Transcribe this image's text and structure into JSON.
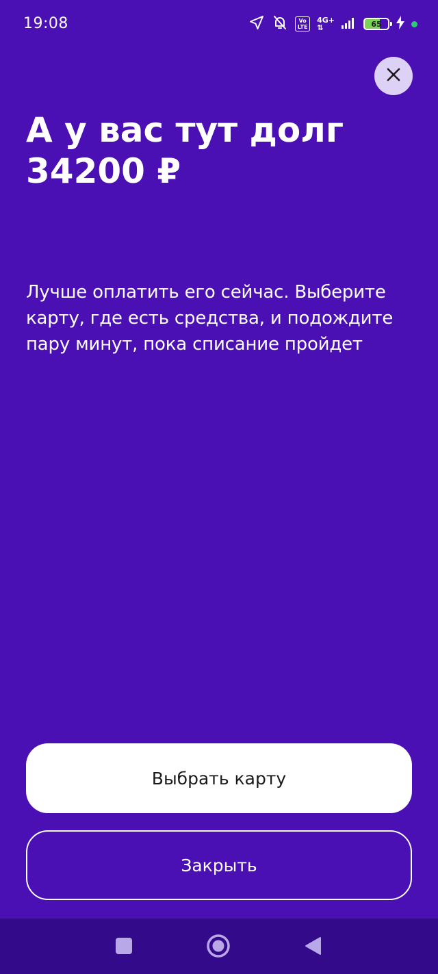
{
  "status_bar": {
    "time": "19:08",
    "volte_top": "Vo",
    "volte_bottom": "LTE",
    "network": "4G+",
    "battery": "65",
    "icons": [
      "location-arrow-icon",
      "bell-off-icon",
      "volte-icon",
      "signal-icon",
      "battery-icon",
      "charging-icon",
      "dot-icon"
    ]
  },
  "dialog": {
    "close_icon": "close-icon",
    "title_line1": "А у вас тут долг",
    "title_line2": "34200 ₽",
    "body_line1": "Лучше оплатить его сейчас. Выберите",
    "body_line2": "карту, где есть средства, и подождите",
    "body_line3": "пару минут, пока списание пройдет",
    "primary_button": "Выбрать карту",
    "secondary_button": "Закрыть"
  },
  "navigation": {
    "icons": [
      "recents-square-icon",
      "home-circle-icon",
      "back-triangle-icon"
    ]
  },
  "colors": {
    "background": "#4a10b4",
    "nav_bar": "#330a8a",
    "close_circle": "#ddd2f6",
    "primary_button_bg": "#ffffff",
    "primary_button_text": "#1a1a1a",
    "battery_fill": "#7dd35a",
    "status_dot": "#2ecc71"
  }
}
